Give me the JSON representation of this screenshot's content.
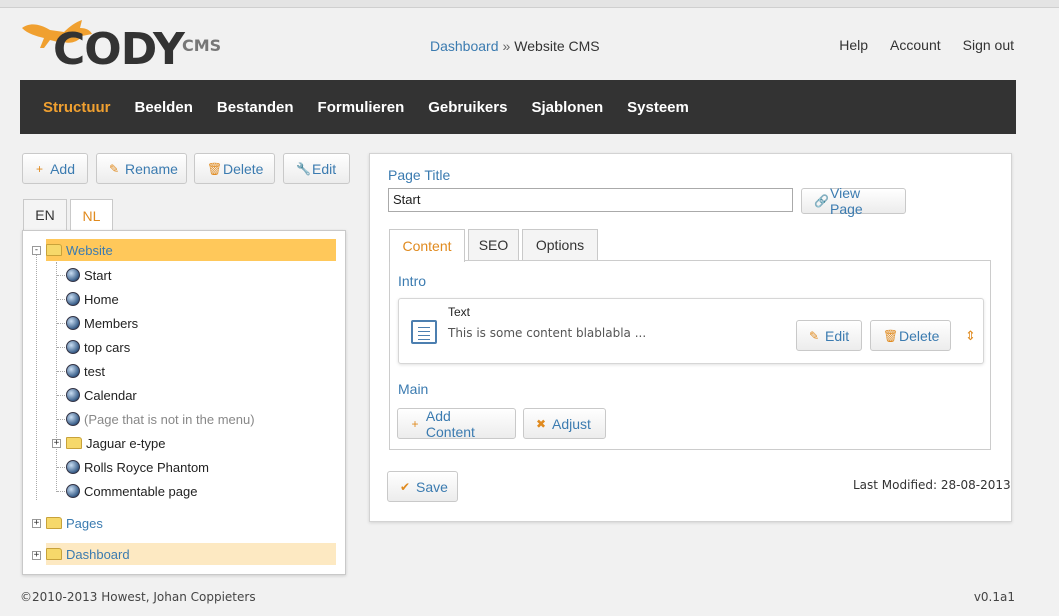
{
  "logo": {
    "name": "CODY",
    "suffix": "CMS"
  },
  "breadcrumb": {
    "link": "Dashboard",
    "separator": "»",
    "current": "Website CMS"
  },
  "toplinks": [
    "Help",
    "Account",
    "Sign out"
  ],
  "nav": {
    "active": "Structuur",
    "items": [
      "Structuur",
      "Beelden",
      "Bestanden",
      "Formulieren",
      "Gebruikers",
      "Sjablonen",
      "Systeem"
    ]
  },
  "toolbar": {
    "add": "Add",
    "rename": "Rename",
    "delete": "Delete",
    "edit": "Edit"
  },
  "lang_tabs": {
    "active": "NL",
    "items": [
      "EN",
      "NL"
    ]
  },
  "tree": {
    "root": "Website",
    "children": [
      "Start",
      "Home",
      "Members",
      "top cars",
      "test",
      "Calendar",
      "(Page that is not in the menu)",
      "Jaguar e-type",
      "Rolls Royce Phantom",
      "Commentable page"
    ],
    "pages": "Pages",
    "dashboard": "Dashboard"
  },
  "page": {
    "title_label": "Page Title",
    "title_value": "Start",
    "view_page": "View Page",
    "tabs": [
      "Content",
      "SEO",
      "Options"
    ],
    "active_tab": "Content",
    "intro_label": "Intro",
    "block": {
      "type": "Text",
      "preview": "This is some content blablabla ...",
      "edit": "Edit",
      "delete": "Delete"
    },
    "main_label": "Main",
    "add_content": "Add Content",
    "adjust": "Adjust",
    "save": "Save",
    "last_modified": "Last Modified: 28-08-2013"
  },
  "footer": {
    "copyright": "©2010-2013 Howest, Johan Coppieters",
    "version": "v0.1a1"
  },
  "colors": {
    "accent": "#e08a1e",
    "link": "#3b7bb0",
    "nav_bg": "#333333",
    "selected_row": "#ffc85a"
  }
}
